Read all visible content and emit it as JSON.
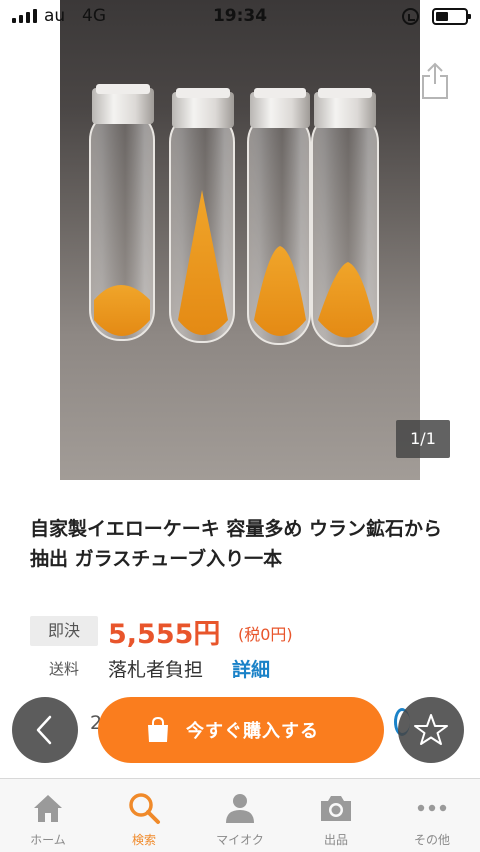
{
  "status_bar": {
    "carrier": "au",
    "network": "4G",
    "time": "19:34",
    "battery_level": 0.4
  },
  "gallery": {
    "counter": "1/1",
    "share_icon": "share-icon"
  },
  "item": {
    "title": "自家製イエローケーキ 容量多め ウラン鉱石から抽出 ガラスチューブ入り一本",
    "price_badge": "即決",
    "price": "5,555円",
    "tax_note": "(税0円)",
    "shipping_label": "送料",
    "shipping_value": "落札者負担",
    "shipping_detail": "詳細",
    "partial_left_text": "2"
  },
  "actions": {
    "buy_label": "今すぐ購入する",
    "back_icon": "chevron-left-icon",
    "watch_icon": "star-icon",
    "buy_icon": "shopping-bag-icon"
  },
  "tabs": [
    {
      "label": "ホーム",
      "icon": "home-icon",
      "active": false
    },
    {
      "label": "検索",
      "icon": "search-icon",
      "active": true
    },
    {
      "label": "マイオク",
      "icon": "person-icon",
      "active": false
    },
    {
      "label": "出品",
      "icon": "camera-icon",
      "active": false
    },
    {
      "label": "その他",
      "icon": "more-icon",
      "active": false
    }
  ],
  "colors": {
    "accent_orange": "#fa7d1e",
    "price_red": "#e8552b",
    "link_blue": "#1a82c8",
    "active_tab": "#f08a2a"
  }
}
